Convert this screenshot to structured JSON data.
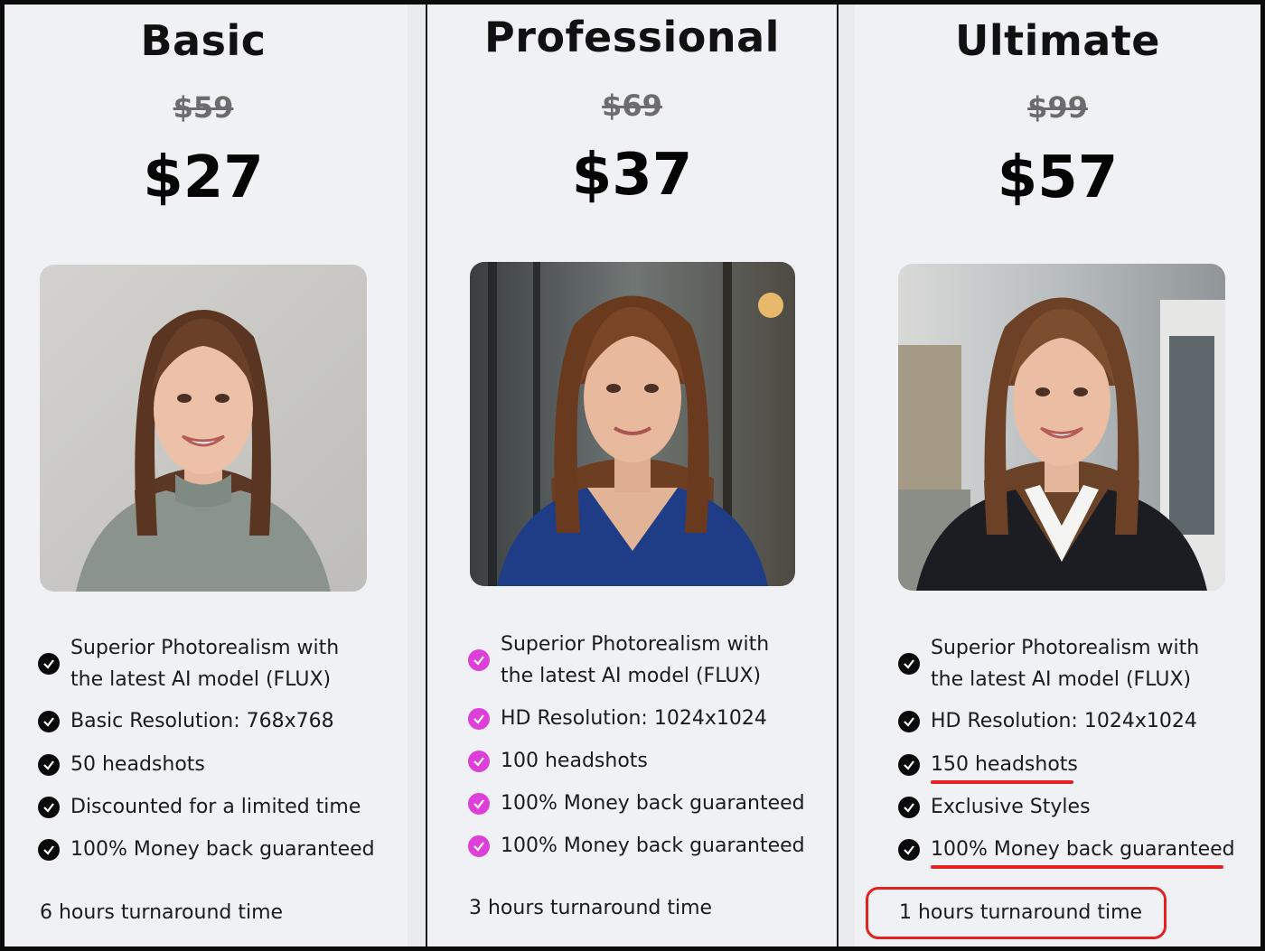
{
  "plans": [
    {
      "name": "Basic",
      "old_price": "$59",
      "price": "$27",
      "features": [
        [
          "Superior Photorealism with",
          "the latest AI model (FLUX)"
        ],
        [
          "Basic Resolution: 768x768"
        ],
        [
          "50 headshots"
        ],
        [
          "Discounted for a limited time"
        ],
        [
          "100% Money back guaranteed"
        ]
      ],
      "turnaround": "6 hours turnaround time",
      "check_color": "#0a0a0a"
    },
    {
      "name": "Professional",
      "old_price": "$69",
      "price": "$37",
      "features": [
        [
          "Superior Photorealism with",
          "the latest AI model (FLUX)"
        ],
        [
          "HD Resolution: 1024x1024"
        ],
        [
          "100 headshots"
        ],
        [
          "100% Money back guaranteed"
        ],
        [
          "100% Money back guaranteed"
        ]
      ],
      "turnaround": "3 hours turnaround time",
      "check_color": "#de3fd9"
    },
    {
      "name": "Ultimate",
      "old_price": "$99",
      "price": "$57",
      "features": [
        [
          "Superior Photorealism with",
          "the latest AI model (FLUX)"
        ],
        [
          "HD Resolution: 1024x1024"
        ],
        [
          "150 headshots"
        ],
        [
          "Exclusive Styles"
        ],
        [
          "100% Money back guaranteed"
        ]
      ],
      "turnaround": "1 hours turnaround time",
      "check_color": "#0a0a0a"
    }
  ],
  "colors": {
    "card_bg": "#f0f1f4",
    "accent_pink": "#de3fd9",
    "annotation_red": "#e32222"
  }
}
